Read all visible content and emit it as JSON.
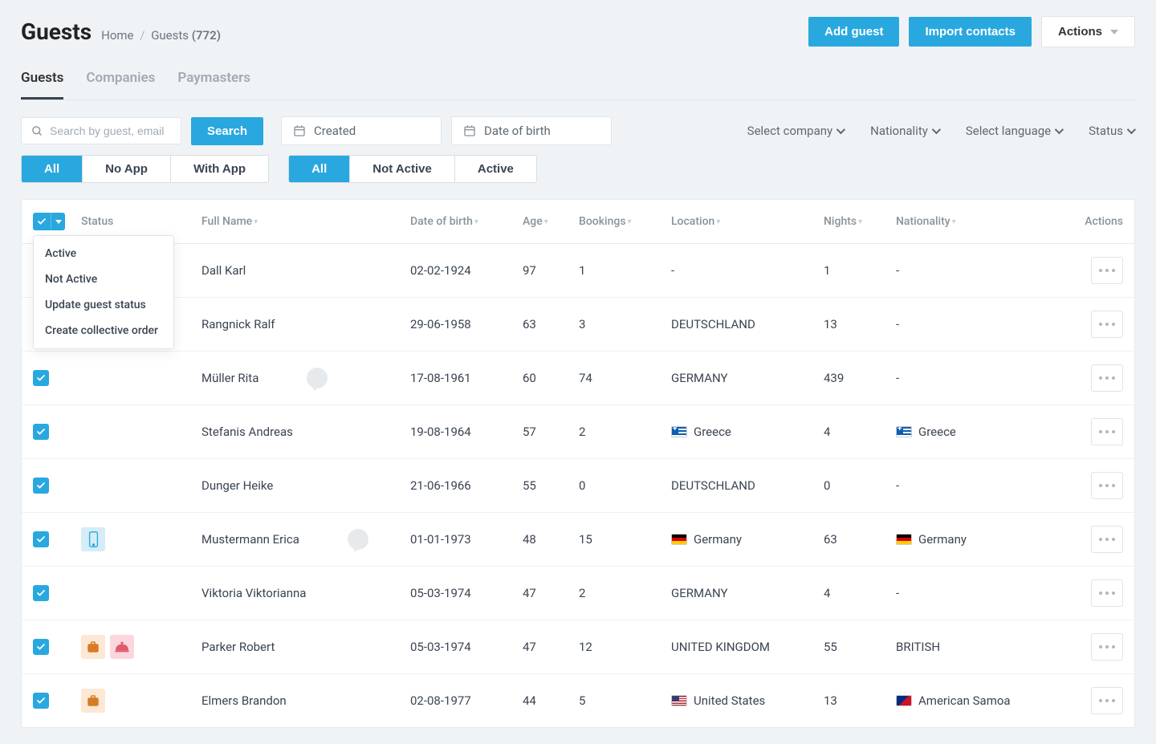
{
  "header": {
    "title": "Guests",
    "breadcrumb_home": "Home",
    "breadcrumb_current": "Guests",
    "count": "(772)",
    "add_guest": "Add guest",
    "import_contacts": "Import contacts",
    "actions_label": "Actions"
  },
  "tabs": {
    "guests": "Guests",
    "companies": "Companies",
    "paymasters": "Paymasters"
  },
  "filters": {
    "search_placeholder": "Search by guest, email",
    "search_button": "Search",
    "created_label": "Created",
    "dob_label": "Date of birth",
    "select_company": "Select company",
    "nationality": "Nationality",
    "select_language": "Select language",
    "status": "Status"
  },
  "segments": {
    "app": {
      "all": "All",
      "no_app": "No App",
      "with_app": "With App"
    },
    "activity": {
      "all": "All",
      "not_active": "Not Active",
      "active": "Active"
    }
  },
  "columns": {
    "status": "Status",
    "full_name": "Full Name",
    "dob": "Date of birth",
    "age": "Age",
    "bookings": "Bookings",
    "location": "Location",
    "nights": "Nights",
    "nationality": "Nationality",
    "actions": "Actions"
  },
  "bulk_menu": {
    "active": "Active",
    "not_active": "Not Active",
    "update_status": "Update guest status",
    "create_order": "Create collective order"
  },
  "rows": [
    {
      "name": "Dall Karl",
      "dob": "02-02-1924",
      "age": "97",
      "bookings": "1",
      "location": "-",
      "nights": "1",
      "nationality": "-",
      "st_phone": false,
      "st_bag": false,
      "st_service": false,
      "st_chat": false,
      "loc_flag": "",
      "nat_flag": ""
    },
    {
      "name": "Rangnick Ralf",
      "dob": "29-06-1958",
      "age": "63",
      "bookings": "3",
      "location": "DEUTSCHLAND",
      "nights": "13",
      "nationality": "-",
      "st_phone": false,
      "st_bag": false,
      "st_service": false,
      "st_chat": false,
      "loc_flag": "",
      "nat_flag": ""
    },
    {
      "name": "Müller Rita",
      "dob": "17-08-1961",
      "age": "60",
      "bookings": "74",
      "location": "GERMANY",
      "nights": "439",
      "nationality": "-",
      "st_phone": false,
      "st_bag": false,
      "st_service": false,
      "st_chat": true,
      "loc_flag": "",
      "nat_flag": ""
    },
    {
      "name": "Stefanis Andreas",
      "dob": "19-08-1964",
      "age": "57",
      "bookings": "2",
      "location": "Greece",
      "nights": "4",
      "nationality": "Greece",
      "st_phone": false,
      "st_bag": false,
      "st_service": false,
      "st_chat": false,
      "loc_flag": "greece",
      "nat_flag": "greece"
    },
    {
      "name": "Dunger Heike",
      "dob": "21-06-1966",
      "age": "55",
      "bookings": "0",
      "location": "DEUTSCHLAND",
      "nights": "0",
      "nationality": "-",
      "st_phone": false,
      "st_bag": false,
      "st_service": false,
      "st_chat": false,
      "loc_flag": "",
      "nat_flag": ""
    },
    {
      "name": "Mustermann Erica",
      "dob": "01-01-1973",
      "age": "48",
      "bookings": "15",
      "location": "Germany",
      "nights": "63",
      "nationality": "Germany",
      "st_phone": true,
      "st_bag": false,
      "st_service": false,
      "st_chat": true,
      "loc_flag": "germany",
      "nat_flag": "germany"
    },
    {
      "name": "Viktoria Viktorianna",
      "dob": "05-03-1974",
      "age": "47",
      "bookings": "2",
      "location": "GERMANY",
      "nights": "4",
      "nationality": "-",
      "st_phone": false,
      "st_bag": false,
      "st_service": false,
      "st_chat": false,
      "loc_flag": "",
      "nat_flag": ""
    },
    {
      "name": "Parker Robert",
      "dob": "05-03-1974",
      "age": "47",
      "bookings": "12",
      "location": "UNITED KINGDOM",
      "nights": "55",
      "nationality": "BRITISH",
      "st_phone": false,
      "st_bag": true,
      "st_service": true,
      "st_chat": false,
      "loc_flag": "",
      "nat_flag": ""
    },
    {
      "name": "Elmers Brandon",
      "dob": "02-08-1977",
      "age": "44",
      "bookings": "5",
      "location": "United States",
      "nights": "13",
      "nationality": "American Samoa",
      "st_phone": false,
      "st_bag": true,
      "st_service": false,
      "st_chat": false,
      "loc_flag": "usa",
      "nat_flag": "samoa"
    }
  ]
}
